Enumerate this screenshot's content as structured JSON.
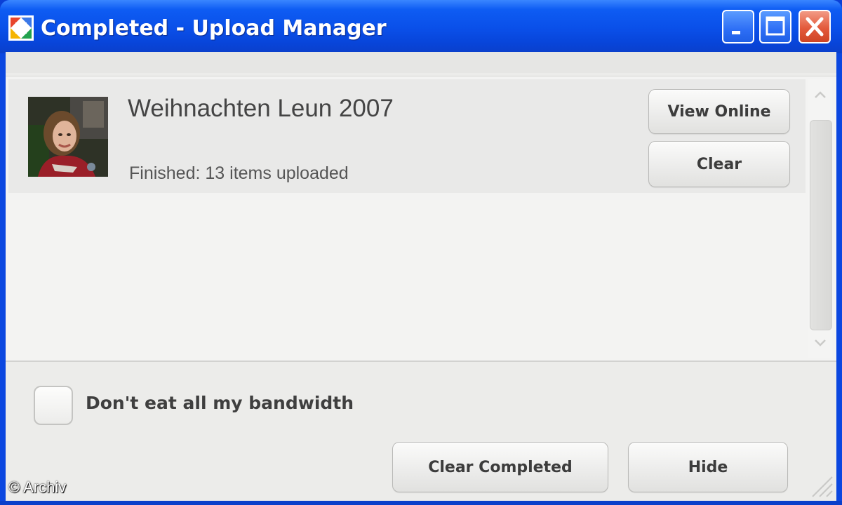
{
  "window": {
    "title": "Completed - Upload Manager",
    "icon": "picasa-colored-square-icon",
    "controls": {
      "minimize": "minimize-icon",
      "maximize": "maximize-icon",
      "close": "close-icon"
    },
    "colors": {
      "titlebar": "#0a4fe8",
      "close_button": "#e35a3c"
    }
  },
  "uploads": [
    {
      "album_title": "Weihnachten Leun 2007",
      "status": "Finished: 13 items uploaded",
      "thumbnail": "photo-thumbnail",
      "view_online_label": "View Online",
      "clear_label": "Clear"
    }
  ],
  "options": {
    "bandwidth_checkbox_label": "Don't eat all my bandwidth",
    "bandwidth_checked": false
  },
  "footer": {
    "clear_completed_label": "Clear Completed",
    "hide_label": "Hide"
  },
  "watermark": "© Archiv"
}
